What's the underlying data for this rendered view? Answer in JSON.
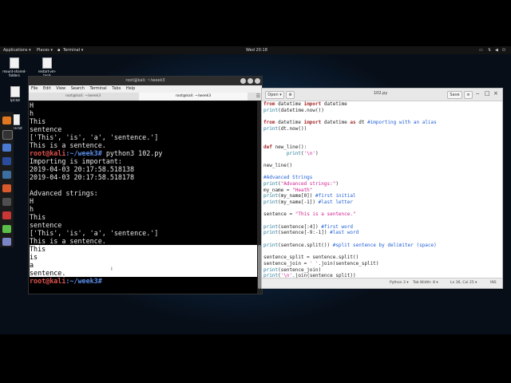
{
  "panel": {
    "applications": "Applications ▾",
    "places": "Places ▾",
    "terminal": "Terminal ▾",
    "clock": "Wed 20:18"
  },
  "desktop_icons": [
    {
      "label": "mount-shared-folders"
    },
    {
      "label": "restart-vm-tools"
    },
    {
      "label": "lpt.txt"
    },
    {
      "label": "place.txt"
    }
  ],
  "terminal": {
    "title": "root@kali: ~/week3",
    "menu": [
      "File",
      "Edit",
      "View",
      "Search",
      "Terminal",
      "Tabs",
      "Help"
    ],
    "tabs": [
      "root@kali: ~/week3",
      "root@kali: ~/week3"
    ],
    "prompt_user": "root@kali",
    "prompt_path": ":~/week3#",
    "lines": [
      "H",
      "h",
      "This",
      "sentence",
      "['This', 'is', 'a', 'sentence.']",
      "This is a sentence.",
      "",
      "Importing is important:",
      "2019-04-03 20:17:58.518138",
      "2019-04-03 20:17:58.518178",
      "",
      "Advanced strings:",
      "H",
      "h",
      "This",
      "sentence",
      "['This', 'is', 'a', 'sentence.']",
      "This is a sentence."
    ],
    "command": " python3 102.py",
    "selected_lines": [
      "This",
      "is",
      "a",
      "sentence."
    ],
    "final_prompt": ""
  },
  "gedit": {
    "open_label": "Open ▾",
    "filename": "102.py",
    "save_label": "Save",
    "status": {
      "lang": "Python 3 ▾",
      "tab": "Tab Width: 8 ▾",
      "pos": "Ln 36, Col 25 ▾",
      "ins": "INS"
    },
    "code": [
      "from datetime import datetime",
      "print(datetime.now())",
      "",
      "from datetime import datetime as dt #importing with an alias",
      "print(dt.now())",
      "",
      "",
      "def new_line():",
      "        print('\\n')",
      "",
      "new_line()",
      "",
      "#Advanced Strings",
      "print(\"Advanced strings:\")",
      "my_name = \"Heath\"",
      "print(my_name[0]) #first initial",
      "print(my_name[-1]) #last letter",
      "",
      "sentence = \"This is a sentence.\"",
      "",
      "print(sentence[:4]) #first word",
      "print(sentence[-9:-1]) #last word",
      "",
      "print(sentence.split()) #split sentence by delimiter (space)",
      "",
      "sentence_split = sentence.split()",
      "sentence_join = ' '.join(sentence_split)",
      "print(sentence_join)",
      "print('\\n'.join(sentence_split))"
    ]
  }
}
